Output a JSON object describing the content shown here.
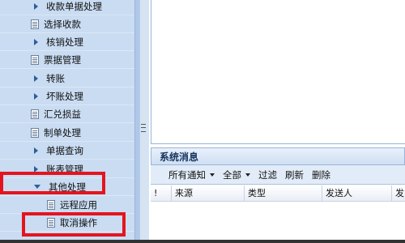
{
  "sidebar": {
    "items": [
      {
        "label": "收款单据处理",
        "icon": "triangle-right-icon"
      },
      {
        "label": "选择收款",
        "icon": "doc-icon"
      },
      {
        "label": "核销处理",
        "icon": "triangle-right-icon"
      },
      {
        "label": "票据管理",
        "icon": "doc-icon"
      },
      {
        "label": "转账",
        "icon": "triangle-right-icon"
      },
      {
        "label": "坏账处理",
        "icon": "triangle-right-icon"
      },
      {
        "label": "汇兑损益",
        "icon": "doc-icon"
      },
      {
        "label": "制单处理",
        "icon": "doc-icon"
      },
      {
        "label": "单据查询",
        "icon": "triangle-right-icon"
      },
      {
        "label": "账表管理",
        "icon": "triangle-right-icon"
      },
      {
        "label": "其他处理",
        "icon": "triangle-down-icon"
      },
      {
        "label": "远程应用",
        "icon": "doc-icon"
      },
      {
        "label": "取消操作",
        "icon": "doc-icon"
      }
    ]
  },
  "message_panel": {
    "title": "系统消息",
    "toolbar": {
      "all_notices": "所有通知",
      "all": "全部",
      "filter": "过滤",
      "refresh": "刷新",
      "delete": "删除"
    },
    "columns": [
      "!",
      "来源",
      "类型",
      "发送人",
      "发"
    ]
  },
  "colors": {
    "sidebar_bg": "#c9dcf2",
    "highlight": "#e4141f",
    "panel_header_text": "#15355f"
  }
}
